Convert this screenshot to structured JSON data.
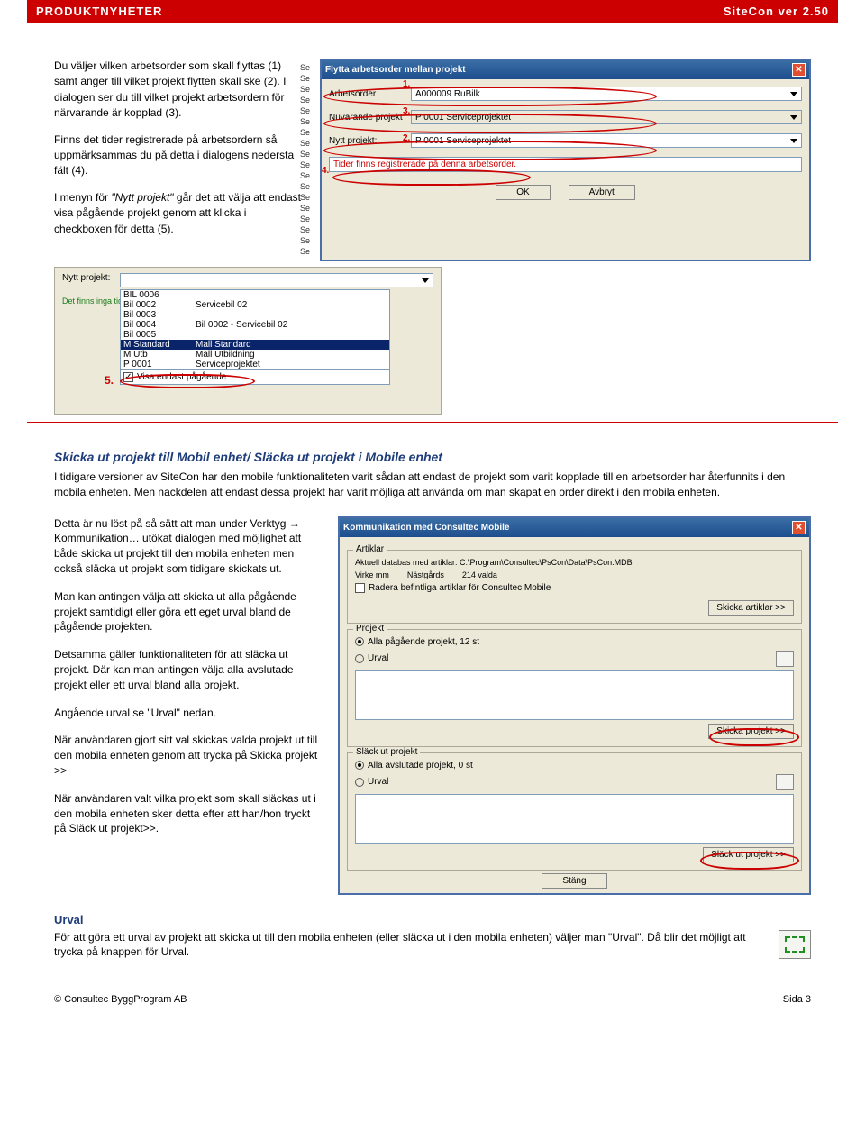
{
  "header": {
    "left": "PRODUKTNYHETER",
    "right": "SiteCon ver 2.50"
  },
  "intro": {
    "p1": "Du väljer vilken arbetsorder som skall flyttas (1) samt anger till vilket projekt flytten skall ske (2). I dialogen ser du till vilket projekt arbetsordern för närvarande är kopplad (3).",
    "p2": "Finns det tider registrerade på arbetsordern så uppmärksammas du på detta i dialogens nedersta fält (4).",
    "p3_pre": "I menyn för ",
    "p3_em": "\"Nytt projekt\"",
    "p3_post": " går det att välja att endast visa pågående projekt genom att klicka i checkboxen för detta (5)."
  },
  "dlg1": {
    "title": "Flytta arbetsorder mellan projekt",
    "lbl_arbets": "Arbetsorder",
    "val_arbets": "A000009     RuBilk",
    "lbl_nuv": "Nuvarande projekt",
    "val_nuv": "P 0001     Serviceprojektet",
    "lbl_nytt": "Nytt projekt:",
    "val_nytt": "P 0001     Serviceprojektet",
    "warn": "Tider finns registrerade på denna arbetsorder.",
    "ok": "OK",
    "cancel": "Avbryt",
    "n1": "1.",
    "n2": "2.",
    "n3": "3.",
    "n4": "4."
  },
  "np": {
    "label": "Nytt projekt:",
    "note": "Det finns inga tider regist",
    "rows": [
      {
        "c": "BIL 0006",
        "d": ""
      },
      {
        "c": "Bil 0002",
        "d": "Servicebil 02"
      },
      {
        "c": "Bil 0003",
        "d": ""
      },
      {
        "c": "Bil 0004",
        "d": "Bil 0002 - Servicebil 02"
      },
      {
        "c": "Bil 0005",
        "d": ""
      },
      {
        "c": "M Standard",
        "d": "Mall Standard"
      },
      {
        "c": "M Utb",
        "d": "Mall Utbildning"
      },
      {
        "c": "P 0001",
        "d": "Serviceprojektet"
      }
    ],
    "chk": "Visa endast pågående",
    "n5": "5."
  },
  "sec2": {
    "h": "Skicka ut projekt till Mobil enhet/ Släcka ut projekt i Mobile enhet",
    "p": "I tidigare versioner av SiteCon har den mobile funktionaliteten varit sådan att endast de projekt som varit kopplade till en arbetsorder har återfunnits i den mobila enheten. Men nackdelen att endast dessa projekt har varit möjliga att använda om man skapat en order direkt i den mobila enheten."
  },
  "col2": {
    "p1_a": "Detta är nu löst på så sätt att man under ",
    "p1_b": "Verktyg → Kommunikation…",
    "p1_c": " utökat dialogen med möjlighet att både skicka ut projekt till den mobila enheten men också släcka ut projekt som tidigare skickats ut.",
    "p2": "Man kan antingen välja att skicka ut alla pågående projekt samtidigt eller göra ett eget urval bland de pågående projekten.",
    "p3": "Detsamma gäller funktionaliteten för att släcka ut projekt. Där kan man antingen välja alla avslutade projekt eller ett urval bland alla projekt.",
    "p4": "Angående urval se \"Urval\" nedan.",
    "p5": "När användaren gjort sitt val skickas valda projekt ut till den mobila enheten genom att trycka på Skicka projekt >>",
    "p6": "När användaren valt vilka projekt som skall släckas ut i den mobila enheten sker detta efter att han/hon tryckt på Släck ut projekt>>."
  },
  "dlg2": {
    "title": "Kommunikation med Consultec Mobile",
    "grp1": "Artiklar",
    "dbpath": "Aktuell databas med artiklar: C:\\Program\\Consultec\\PsCon\\Data\\PsCon.MDB",
    "vk": "Virke mm",
    "nast": "Nästgårds",
    "valda": "214 valda",
    "chkr": "Radera befintliga artiklar för Consultec Mobile",
    "btn_art": "Skicka artiklar >>",
    "grp2": "Projekt",
    "r1": "Alla pågående projekt, 12 st",
    "r2": "Urval",
    "btn_proj": "Skicka projekt >>",
    "grp3": "Släck ut projekt",
    "r3": "Alla avslutade projekt, 0 st",
    "r4": "Urval",
    "btn_slack": "Släck ut projekt >>",
    "stang": "Stäng"
  },
  "urval": {
    "h": "Urval",
    "p": "För att göra ett urval av projekt att skicka ut till den mobila enheten (eller släcka ut i den mobila enheten) väljer man \"Urval\". Då blir det möjligt att trycka på knappen för Urval."
  },
  "footer": {
    "left": "© Consultec ByggProgram AB",
    "right": "Sida 3"
  }
}
